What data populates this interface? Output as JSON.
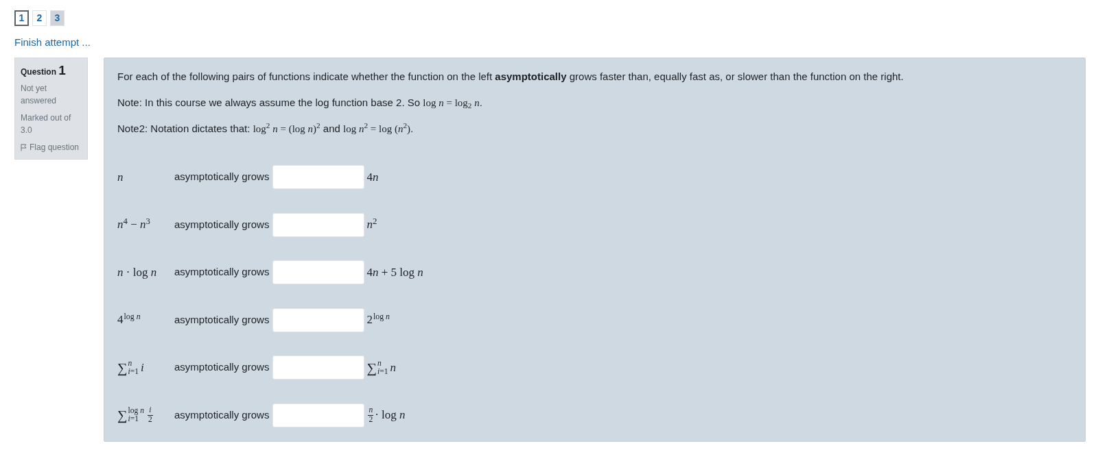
{
  "nav": {
    "pages": [
      {
        "label": "1",
        "selected": true,
        "answered": false
      },
      {
        "label": "2",
        "selected": false,
        "answered": false
      },
      {
        "label": "3",
        "selected": false,
        "answered": true
      }
    ]
  },
  "finish_link": "Finish attempt ...",
  "question_info": {
    "label": "Question",
    "number": "1",
    "status": "Not yet answered",
    "marks": "Marked out of 3.0",
    "flag_label": "Flag question"
  },
  "question": {
    "paragraphs": [
      {
        "segments": [
          {
            "kind": "text",
            "text": "For each of the following pairs of functions indicate whether the function on the left **asymptotically** grows faster than, equally fast as, or slower than the function on the right."
          }
        ]
      },
      {
        "segments": [
          {
            "kind": "text",
            "text": "Note: In this course we always assume the log function base 2. So "
          },
          {
            "kind": "math",
            "text": "log *n* = log$_{2}$ *n*"
          },
          {
            "kind": "text",
            "text": "."
          }
        ]
      },
      {
        "segments": [
          {
            "kind": "text",
            "text": "Note2: Notation dictates that: "
          },
          {
            "kind": "math",
            "text": "log$^{2}$ *n* = (log *n*)$^{2}$"
          },
          {
            "kind": "text",
            "text": " and "
          },
          {
            "kind": "math",
            "text": "log *n*$^{2}$ = log (*n*$^{2}$)"
          },
          {
            "kind": "text",
            "text": "."
          }
        ]
      }
    ],
    "rows": [
      {
        "left": [
          {
            "kind": "math",
            "text": "*n*"
          }
        ],
        "label": "asymptotically grows",
        "right": [
          {
            "kind": "math",
            "text": "4"
          },
          {
            "kind": "math",
            "text": "*n*"
          }
        ]
      },
      {
        "left": [
          {
            "kind": "math",
            "text": "*n*$^{4}$ − *n*$^{3}$"
          }
        ],
        "label": "asymptotically grows",
        "right": [
          {
            "kind": "math",
            "text": "*n*$^{2}$"
          }
        ]
      },
      {
        "left": [
          {
            "kind": "math",
            "text": "*n* · log *n*"
          }
        ],
        "label": "asymptotically grows",
        "right": [
          {
            "kind": "math",
            "text": "4"
          },
          {
            "kind": "math",
            "text": "*n* + 5 log *n*"
          }
        ]
      },
      {
        "left": [
          {
            "kind": "power",
            "base": "4",
            "exponent": "log *n*"
          }
        ],
        "label": "asymptotically grows",
        "right": [
          {
            "kind": "power",
            "base": "2",
            "exponent": "log *n*"
          }
        ]
      },
      {
        "left": [
          {
            "kind": "sum",
            "symbol": "∑",
            "upper": "*n*",
            "lower": "*i*=1"
          },
          {
            "kind": "math",
            "text": "*i*"
          }
        ],
        "label": "asymptotically grows",
        "right": [
          {
            "kind": "sum",
            "symbol": "∑",
            "upper": "*n*",
            "lower": "*i*=1"
          },
          {
            "kind": "math",
            "text": "*n*"
          }
        ]
      },
      {
        "left": [
          {
            "kind": "sum",
            "symbol": "∑",
            "upper": "log *n*",
            "lower": "*i*=1"
          },
          {
            "kind": "frac",
            "num": "*i*",
            "den": "2"
          }
        ],
        "label": "asymptotically grows",
        "right": [
          {
            "kind": "frac",
            "num": "*n*",
            "den": "2"
          },
          {
            "kind": "math",
            "text": "· log *n*"
          }
        ]
      }
    ]
  }
}
